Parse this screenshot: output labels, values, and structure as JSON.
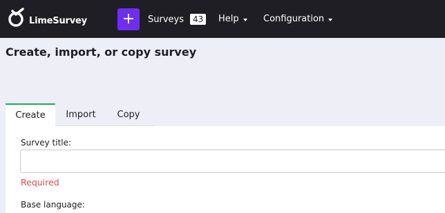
{
  "navbar": {
    "brand": "LimeSurvey",
    "create_button": "+",
    "surveys_label": "Surveys",
    "surveys_count": "43",
    "help_label": "Help",
    "configuration_label": "Configuration"
  },
  "page": {
    "title": "Create, import, or copy survey"
  },
  "tabs": [
    {
      "label": "Create",
      "active": true
    },
    {
      "label": "Import",
      "active": false
    },
    {
      "label": "Copy",
      "active": false
    }
  ],
  "form": {
    "survey_title_label": "Survey title:",
    "survey_title_value": "",
    "required_text": "Required",
    "base_language_label": "Base language:"
  },
  "colors": {
    "navbar_bg": "#1e1e24",
    "accent_purple": "#6d2ef0",
    "active_tab_border": "#14ae5c",
    "error_red": "#e0474d",
    "page_bg": "#eeeef6"
  }
}
